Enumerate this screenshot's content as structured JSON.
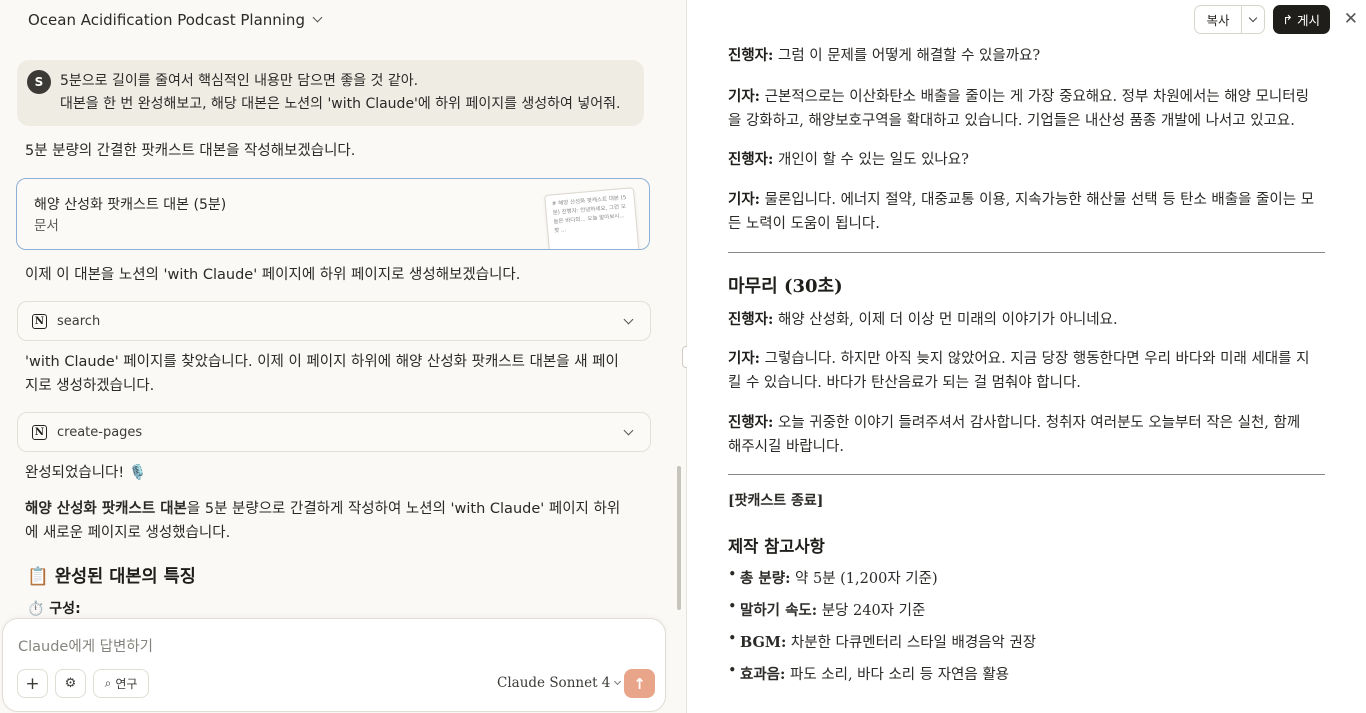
{
  "chat": {
    "title": "Ocean Acidification Podcast Planning",
    "user_avatar": "S",
    "user_line1": "5분으로 길이를 줄여서 핵심적인 내용만 담으면 좋을 것 같아.",
    "user_line2": "대본을 한 번 완성해보고, 해당 대본은 노션의 'with Claude'에 하위 페이지를 생성하여 넣어줘.",
    "reply1": "5분 분량의 간결한 팟캐스트 대본을 작성해보겠습니다.",
    "artifact_title": "해양 산성화 팟캐스트 대본 (5분)",
    "artifact_type": "문서",
    "artifact_thumb": "# 해양 산성화 팟캐스트 대본 (5분) 진행자: 안녕하세요, 그런 오늘은 바다의... 오늘 알아보시... 팟 ...",
    "reply2": "이제 이 대본을 노션의 'with Claude' 페이지에 하위 페이지로 생성해보겠습니다.",
    "tool1": "search",
    "reply3_line1": "'with Claude' 페이지를 찾았습니다. 이제 이 페이지 하위에 해양 산성화 팟캐스트 대본을 새 페이",
    "reply3_line2": "지로 생성하겠습니다.",
    "tool2": "create-pages",
    "done": "완성되었습니다! 🎙️",
    "summary_bold": "해양 산성화 팟캐스트 대본",
    "summary_rest": "을 5분 분량으로 간결하게 작성하여 노션의 'with Claude' 페이지 하위",
    "summary_line2": "에 새로운 페이지로 생성했습니다.",
    "heading": "📋 완성된 대본의 특징",
    "subheading": "⏱️ 구성:",
    "composer_placeholder": "Claude에게 답변하기",
    "plus_label": "+",
    "tools_label": "⚙",
    "research_label": "연구",
    "model": "Claude Sonnet 4",
    "send_icon": "↑"
  },
  "doc": {
    "copy_label": "복사",
    "publish_label": "게시",
    "close_icon": "✕",
    "speaker_host": "진행자:",
    "speaker_reporter": "기자:",
    "l1": " 그럼 이 문제를 어떻게 해결할 수 있을까요?",
    "l2a": " 근본적으로는 이산화탄소 배출을 줄이는 게 가장 중요해요. 정부 차원에서는 해양 모니터링",
    "l2b": "을 강화하고, 해양보호구역을 확대하고 있습니다. 기업들은 내산성 품종 개발에 나서고 있고요.",
    "l3": " 개인이 할 수 있는 일도 있나요?",
    "l4a": " 물론입니다. 에너지 절약, 대중교통 이용, 지속가능한 해산물 선택 등 탄소 배출을 줄이는 모",
    "l4b": "든 노력이 도움이 됩니다.",
    "section_end": "마무리 (30초)",
    "l5": " 해양 산성화, 이제 더 이상 먼 미래의 이야기가 아니네요.",
    "l6a": " 그렇습니다. 하지만 아직 늦지 않았어요. 지금 당장 행동한다면 우리 바다와 미래 세대를 지",
    "l6b": "킬 수 있습니다. 바다가 탄산음료가 되는 걸 멈춰야 합니다.",
    "l7a": " 오늘 귀중한 이야기 들려주셔서 감사합니다. 청취자 여러분도 오늘부터 작은 실천, 함께",
    "l7b": "해주시길 바랍니다.",
    "end_mark": "[팟캐스트 종료]",
    "notes_heading": "제작 참고사항",
    "notes": [
      {
        "k": "총 분량:",
        "v": " 약 5분 (1,200자 기준)"
      },
      {
        "k": "말하기 속도:",
        "v": " 분당 240자 기준"
      },
      {
        "k": "BGM:",
        "v": " 차분한 다큐멘터리 스타일 배경음악 권장"
      },
      {
        "k": "효과음:",
        "v": " 파도 소리, 바다 소리 등 자연음 활용"
      }
    ]
  }
}
